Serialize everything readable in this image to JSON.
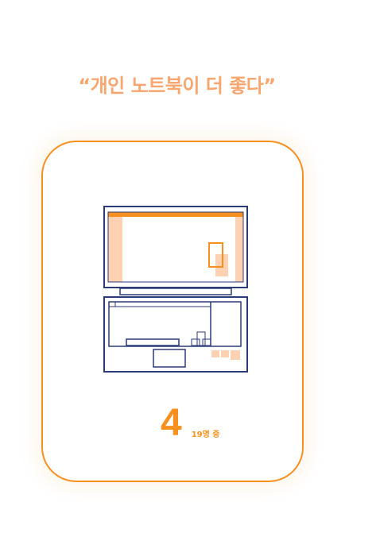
{
  "headline": "“개인 노트북이 더 좋다”",
  "stat": {
    "count": "4",
    "suffix": "19명 중"
  },
  "illustration": {
    "icon": "laptop-icon",
    "stroke_color": "#2b3a78",
    "accent_color": "#f7901e",
    "fill_color": "#ffd1b3"
  },
  "colors": {
    "headline": "#f7a66f",
    "border": "#f7901e"
  }
}
